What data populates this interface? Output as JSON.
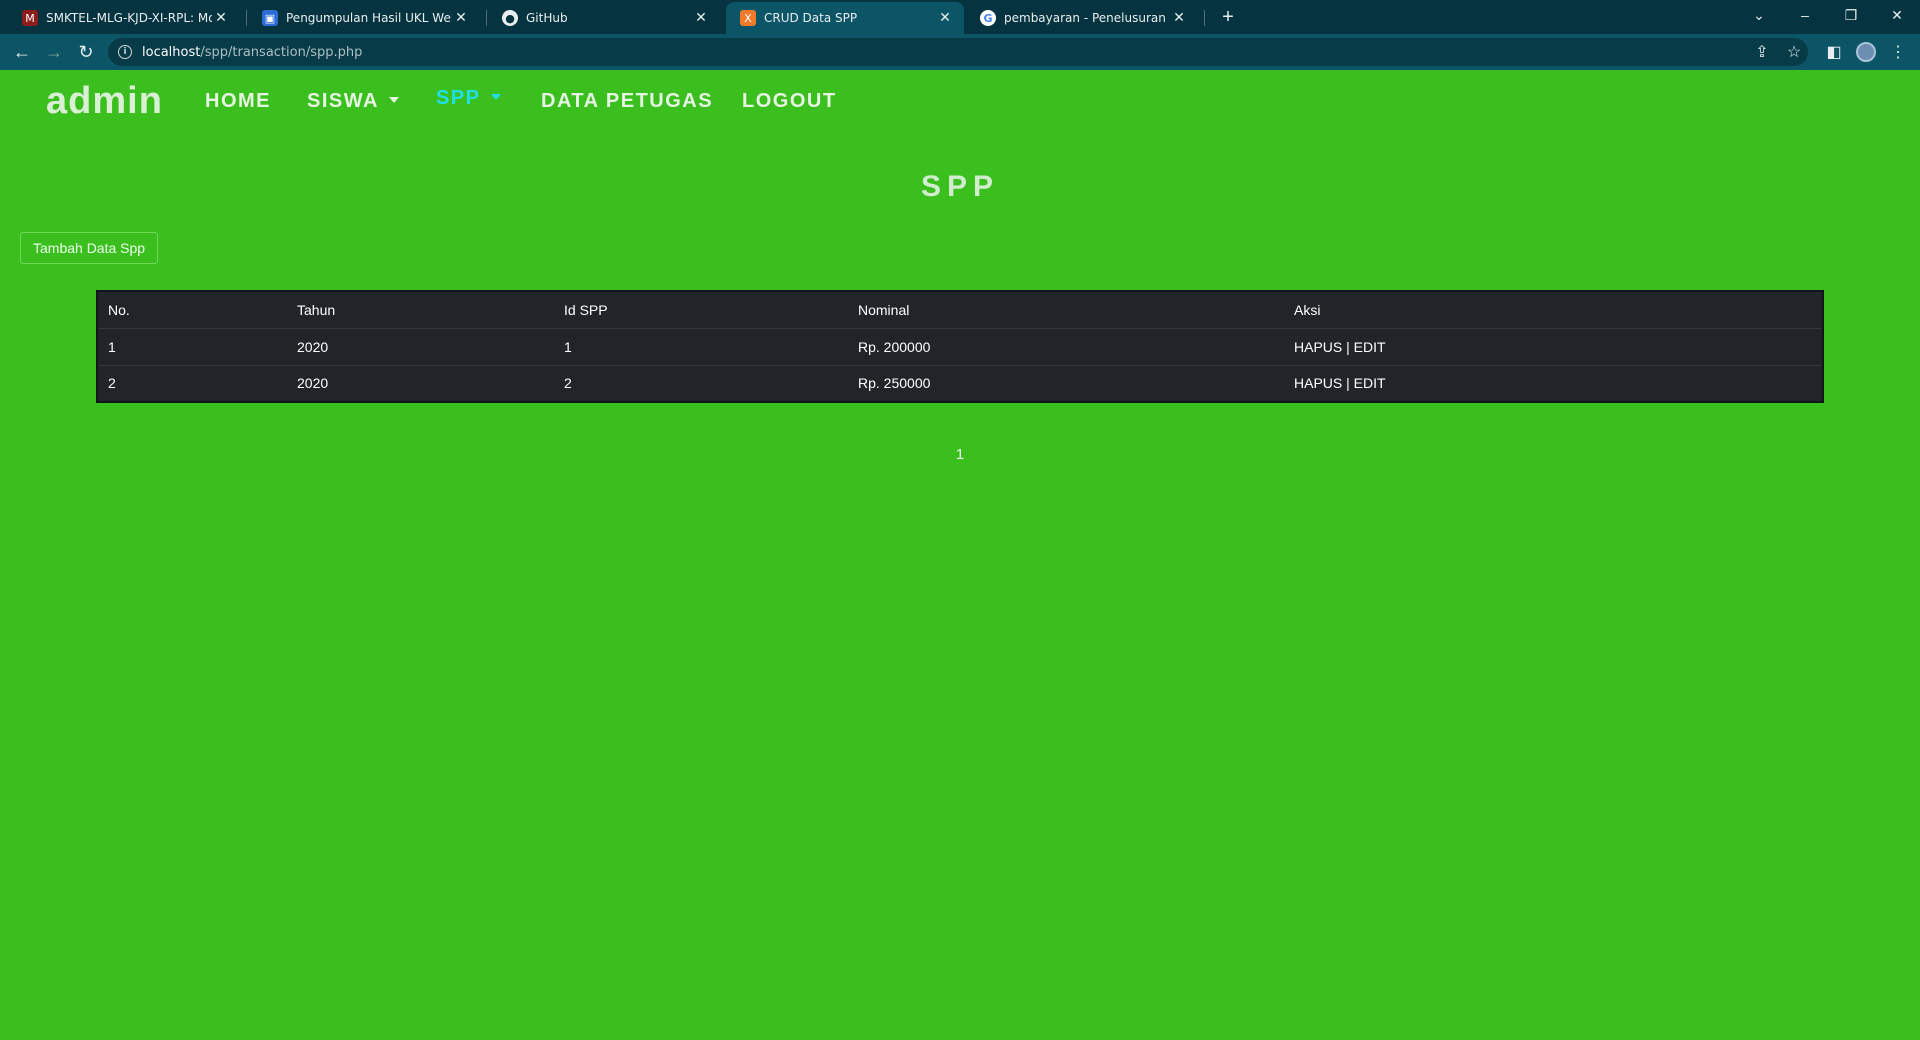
{
  "browser": {
    "tabs": [
      {
        "title": "SMKTEL-MLG-KJD-XI-RPL: Modul",
        "favicon": "moodle-icon",
        "active": false
      },
      {
        "title": "Pengumpulan Hasil UKL Web",
        "favicon": "classroom-icon",
        "active": false
      },
      {
        "title": "GitHub",
        "favicon": "github-icon",
        "active": false
      },
      {
        "title": "CRUD Data SPP",
        "favicon": "xampp-icon",
        "active": true
      },
      {
        "title": "pembayaran - Penelusuran Google",
        "favicon": "google-icon",
        "active": false
      }
    ],
    "url_host": "localhost",
    "url_path": "/spp/transaction/spp.php"
  },
  "nav": {
    "brand": "admin",
    "links": [
      "HOME",
      "SISWA",
      "SPP",
      "DATA PETUGAS",
      "LOGOUT"
    ],
    "active_link": "SPP"
  },
  "page": {
    "title": "SPP",
    "add_button": "Tambah Data Spp"
  },
  "table": {
    "headers": [
      "No.",
      "Tahun",
      "Id SPP",
      "Nominal",
      "Aksi"
    ],
    "rows": [
      {
        "no": "1",
        "tahun": "2020",
        "id_spp": "1",
        "nominal": "Rp. 200000",
        "hapus": "HAPUS",
        "sep": "|",
        "edit": "EDIT"
      },
      {
        "no": "2",
        "tahun": "2020",
        "id_spp": "2",
        "nominal": "Rp. 250000",
        "hapus": "HAPUS",
        "sep": "|",
        "edit": "EDIT"
      }
    ]
  },
  "pagination": {
    "current": "1"
  },
  "colors": {
    "page_bg": "#3bbf1e",
    "active_nav": "#1fe0e6",
    "table_bg": "#212529",
    "chrome_dark": "#05333f",
    "chrome_toolbar": "#0b5566"
  }
}
